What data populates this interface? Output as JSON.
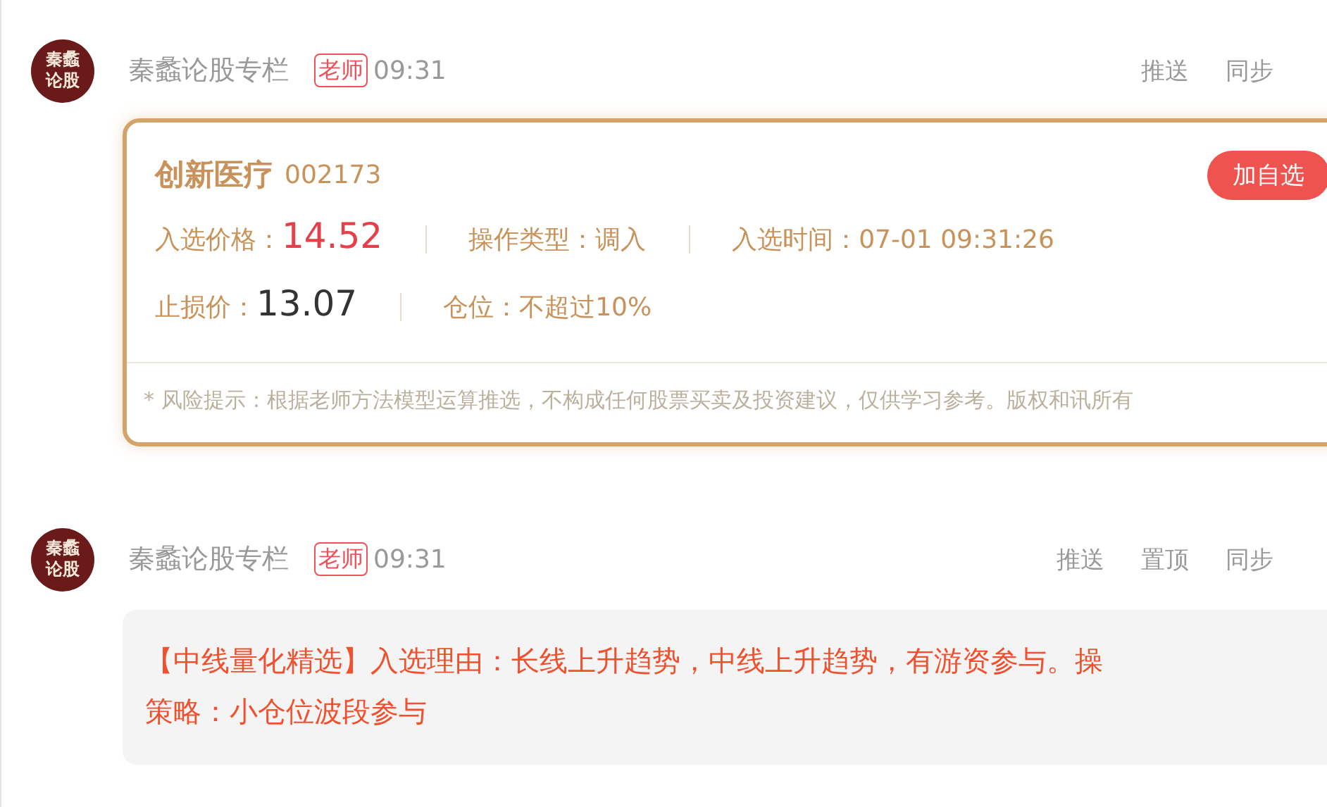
{
  "messages": [
    {
      "kind": "signal",
      "avatar_lines": [
        "秦蠡",
        "论股"
      ],
      "author": "秦蠡论股专栏",
      "badge": "老师",
      "time": "09:31",
      "actions": [
        "推送",
        "同步"
      ],
      "stock": {
        "name": "创新医疗",
        "code": "002173",
        "button": "加自选"
      },
      "rows": [
        [
          {
            "label": "入选价格：",
            "value": "14.52",
            "kind": "price"
          },
          {
            "label": "操作类型：",
            "value": "调入",
            "kind": "plain"
          },
          {
            "label": "入选时间：",
            "value": "07-01 09:31:26",
            "kind": "plain"
          }
        ],
        [
          {
            "label": "止损价：",
            "value": "13.07",
            "kind": "stop"
          },
          {
            "label": "仓位：",
            "value": "不超过10%",
            "kind": "plain"
          }
        ]
      ],
      "disclaimer": "* 风险提示：根据老师方法模型运算推选，不构成任何股票买卖及投资建议，仅供学习参考。版权和讯所有"
    },
    {
      "kind": "text",
      "avatar_lines": [
        "秦蠡",
        "论股"
      ],
      "author": "秦蠡论股专栏",
      "badge": "老师",
      "time": "09:31",
      "actions": [
        "推送",
        "置顶",
        "同步"
      ],
      "lines": [
        "【中线量化精选】入选理由：长线上升趋势，中线上升趋势，有游资参与。操",
        "策略：小仓位波段参与"
      ]
    }
  ]
}
